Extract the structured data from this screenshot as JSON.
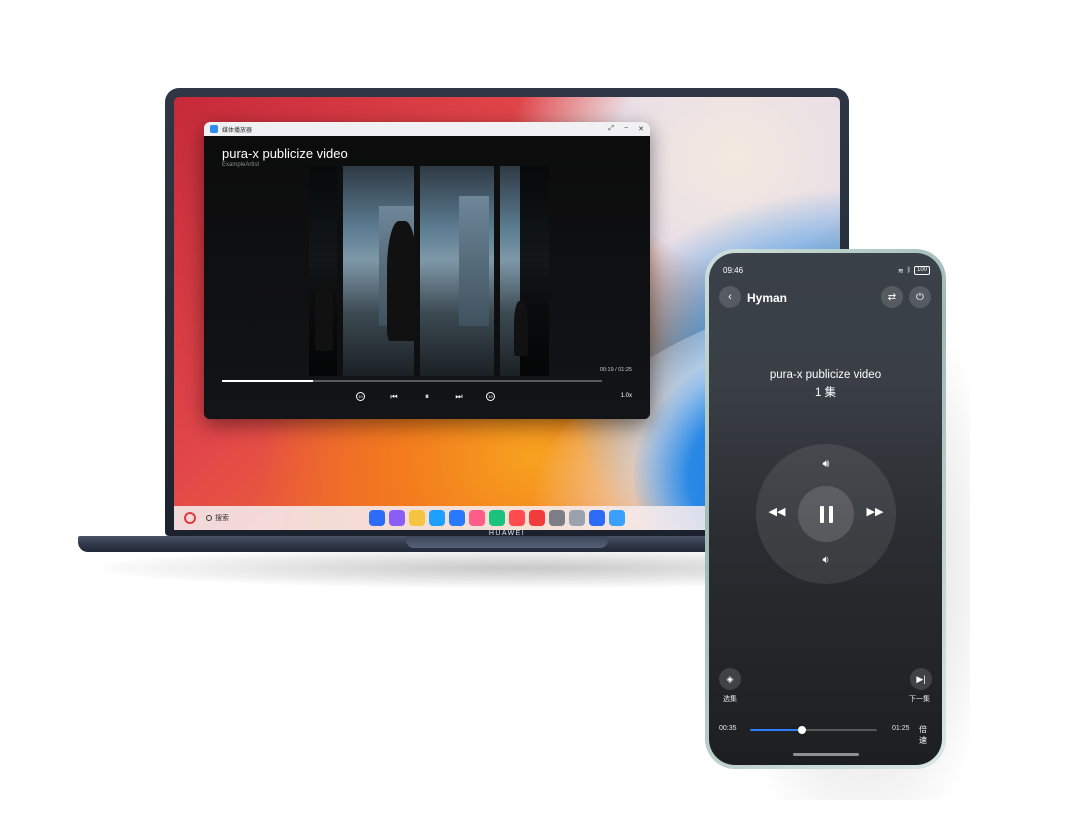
{
  "laptop": {
    "brand": "HUAWEI",
    "taskbar": {
      "search_label": "搜索"
    },
    "dock_colors": [
      "#2d6cf6",
      "#8b5cf6",
      "#f5c542",
      "#1ea0ff",
      "#2979ff",
      "#ff5c8a",
      "#19c37d",
      "#ff4d4f",
      "#f23c3c",
      "#7d7d85",
      "#9aa3ad",
      "#2d6cf6",
      "#3aa0ff"
    ],
    "media_window": {
      "title": "媒体播放器",
      "min_label": "−",
      "restore_label": "⤢",
      "close_label": "✕",
      "video_title": "pura-x publicize video",
      "artist": "ExampleArtist",
      "time": "00:19 / 01:25",
      "progress": 0.24,
      "rewind_label": "10",
      "forward_label": "10",
      "speed": "1.0x"
    }
  },
  "phone": {
    "status_time": "09:46",
    "battery": "100",
    "device_name": "Hyman",
    "media_title": "pura-x publicize video",
    "episode": "1 集",
    "playlist_label": "选集",
    "next_label": "下一集",
    "elapsed": "00:35",
    "duration": "01:25",
    "progress": 0.41,
    "speed_label": "倍速"
  },
  "colors": {
    "accent": "#2e7dff",
    "app_icon": "#2d8cf0"
  }
}
